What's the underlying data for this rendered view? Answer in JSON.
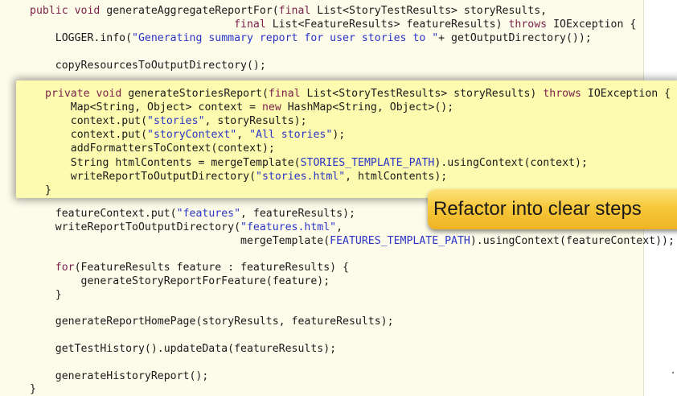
{
  "background_code": [
    {
      "line": 1,
      "parts": [
        {
          "t": "kw",
          "v": "public void"
        },
        {
          "t": "txt",
          "v": " generateAggregateReportFor("
        },
        {
          "t": "kw",
          "v": "final"
        },
        {
          "t": "txt",
          "v": " List<StoryTestResults> storyResults,"
        }
      ]
    },
    {
      "line": 2,
      "parts": [
        {
          "t": "txt",
          "v": "                                "
        },
        {
          "t": "kw",
          "v": "final"
        },
        {
          "t": "txt",
          "v": " List<FeatureResults> featureResults) "
        },
        {
          "t": "kw",
          "v": "throws"
        },
        {
          "t": "txt",
          "v": " IOException {"
        }
      ]
    },
    {
      "line": 3,
      "parts": [
        {
          "t": "txt",
          "v": "    LOGGER.info("
        },
        {
          "t": "str",
          "v": "\"Generating summary report for user stories to \""
        },
        {
          "t": "txt",
          "v": "+ getOutputDirectory());"
        }
      ]
    },
    {
      "line": 4,
      "parts": [
        {
          "t": "txt",
          "v": "    copyResourcesToOutputDirectory();"
        }
      ]
    },
    {
      "line": 5,
      "parts": [
        {
          "t": "txt",
          "v": "    featureContext.put("
        },
        {
          "t": "str",
          "v": "\"features\""
        },
        {
          "t": "txt",
          "v": ", featureResults);"
        }
      ]
    },
    {
      "line": 6,
      "parts": [
        {
          "t": "txt",
          "v": "    writeReportToOutputDirectory("
        },
        {
          "t": "str",
          "v": "\"features.html\""
        },
        {
          "t": "txt",
          "v": ","
        }
      ]
    },
    {
      "line": 7,
      "parts": [
        {
          "t": "txt",
          "v": "                                 mergeTemplate("
        },
        {
          "t": "const",
          "v": "FEATURES_TEMPLATE_PATH"
        },
        {
          "t": "txt",
          "v": ").usingContext(featureContext));"
        }
      ]
    },
    {
      "line": 8,
      "parts": [
        {
          "t": "kw",
          "v": "    for"
        },
        {
          "t": "txt",
          "v": "(FeatureResults feature : featureResults) {"
        }
      ]
    },
    {
      "line": 9,
      "parts": [
        {
          "t": "txt",
          "v": "        generateStoryReportForFeature(feature);"
        }
      ]
    },
    {
      "line": 10,
      "parts": [
        {
          "t": "txt",
          "v": "    }"
        }
      ]
    },
    {
      "line": 11,
      "parts": [
        {
          "t": "txt",
          "v": "    generateReportHomePage(storyResults, featureResults);"
        }
      ]
    },
    {
      "line": 12,
      "parts": [
        {
          "t": "txt",
          "v": "    getTestHistory().updateData(featureResults);"
        }
      ]
    },
    {
      "line": 13,
      "parts": [
        {
          "t": "txt",
          "v": "    generateHistoryReport();"
        }
      ]
    },
    {
      "line": 14,
      "parts": [
        {
          "t": "txt",
          "v": "}"
        }
      ]
    }
  ],
  "popup_code": [
    {
      "line": 1,
      "parts": [
        {
          "t": "kw",
          "v": "private void"
        },
        {
          "t": "txt",
          "v": " generateStoriesReport("
        },
        {
          "t": "kw",
          "v": "final"
        },
        {
          "t": "txt",
          "v": " List<StoryTestResults> storyResults) "
        },
        {
          "t": "kw",
          "v": "throws"
        },
        {
          "t": "txt",
          "v": " IOException {"
        }
      ]
    },
    {
      "line": 2,
      "parts": [
        {
          "t": "txt",
          "v": "    Map<String, Object> context = "
        },
        {
          "t": "kw",
          "v": "new"
        },
        {
          "t": "txt",
          "v": " HashMap<String, Object>();"
        }
      ]
    },
    {
      "line": 3,
      "parts": [
        {
          "t": "txt",
          "v": "    context.put("
        },
        {
          "t": "str",
          "v": "\"stories\""
        },
        {
          "t": "txt",
          "v": ", storyResults);"
        }
      ]
    },
    {
      "line": 4,
      "parts": [
        {
          "t": "txt",
          "v": "    context.put("
        },
        {
          "t": "str",
          "v": "\"storyContext\""
        },
        {
          "t": "txt",
          "v": ", "
        },
        {
          "t": "str",
          "v": "\"All stories\""
        },
        {
          "t": "txt",
          "v": ");"
        }
      ]
    },
    {
      "line": 5,
      "parts": [
        {
          "t": "txt",
          "v": "    addFormattersToContext(context);"
        }
      ]
    },
    {
      "line": 6,
      "parts": [
        {
          "t": "txt",
          "v": "    String htmlContents = mergeTemplate("
        },
        {
          "t": "const",
          "v": "STORIES_TEMPLATE_PATH"
        },
        {
          "t": "txt",
          "v": ").usingContext(context);"
        }
      ]
    },
    {
      "line": 7,
      "parts": [
        {
          "t": "txt",
          "v": "    writeReportToOutputDirectory("
        },
        {
          "t": "str",
          "v": "\"stories.html\""
        },
        {
          "t": "txt",
          "v": ", htmlContents);"
        }
      ]
    },
    {
      "line": 8,
      "parts": [
        {
          "t": "txt",
          "v": "}"
        }
      ]
    }
  ],
  "callout": {
    "label": "Refactor into clear steps"
  },
  "colors": {
    "keyword": "#7a1f4a",
    "string": "#2a35c8",
    "page_background": "#fdfbea",
    "popup_background": "#fdfbb0",
    "callout_top": "#fde37a",
    "callout_bottom": "#eeb323"
  }
}
